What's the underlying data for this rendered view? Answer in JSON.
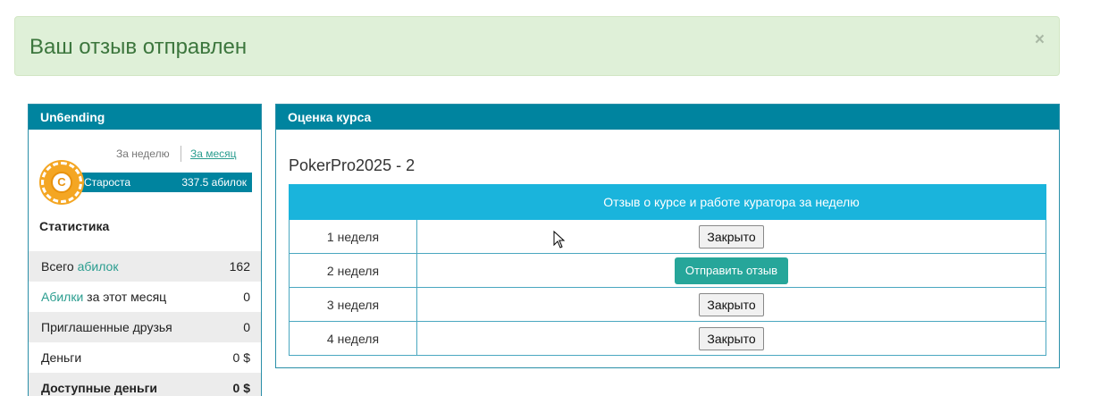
{
  "alert": {
    "message": "Ваш отзыв отправлен",
    "close_glyph": "×"
  },
  "sidebar": {
    "title": "Un6ending",
    "period": {
      "week_label": "За неделю",
      "month_label": "За месяц",
      "active": "За месяц"
    },
    "badge_letter": "C",
    "rank": {
      "name": "Староста",
      "value": "337.5 абилок"
    },
    "stats_title": "Статистика",
    "stats": [
      {
        "prefix": "Всего ",
        "link": "абилок",
        "suffix": "",
        "value": "162"
      },
      {
        "prefix": "",
        "link": "Абилки",
        "suffix": " за этот месяц",
        "value": "0"
      },
      {
        "prefix": "Приглашенные друзья",
        "link": "",
        "suffix": "",
        "value": "0"
      },
      {
        "prefix": "Деньги",
        "link": "",
        "suffix": "",
        "value": "0 $"
      },
      {
        "prefix": "Доступные деньги",
        "link": "",
        "suffix": "",
        "value": "0 $"
      }
    ]
  },
  "main": {
    "title": "Оценка курса",
    "course_name": "PokerPro2025 - 2",
    "table": {
      "header_week": "",
      "header_review": "Отзыв о курсе и работе куратора за неделю",
      "rows": [
        {
          "week": "1 неделя",
          "action": "Закрыто",
          "type": "closed"
        },
        {
          "week": "2 неделя",
          "action": "Отправить отзыв",
          "type": "send"
        },
        {
          "week": "3 неделя",
          "action": "Закрыто",
          "type": "closed"
        },
        {
          "week": "4 неделя",
          "action": "Закрыто",
          "type": "closed"
        }
      ]
    }
  },
  "colors": {
    "panel_header": "#00849f",
    "table_header": "#1ab4dc",
    "alert_bg": "#dff0d8",
    "alert_text": "#3c763d",
    "send_button": "#26a69a",
    "link": "#2a9d8f",
    "badge": "#f4a623"
  }
}
